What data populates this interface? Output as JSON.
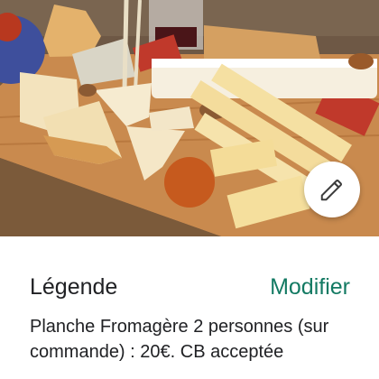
{
  "photo": {
    "subject": "cheese-board"
  },
  "edit_button": {
    "icon": "pencil-icon"
  },
  "legend": {
    "label": "Légende",
    "modify_label": "Modifier",
    "caption": "Planche Fromagère 2 personnes (sur commande) : 20€. CB acceptée"
  },
  "colors": {
    "accent": "#137a63",
    "text": "#202124",
    "background": "#ffffff"
  }
}
